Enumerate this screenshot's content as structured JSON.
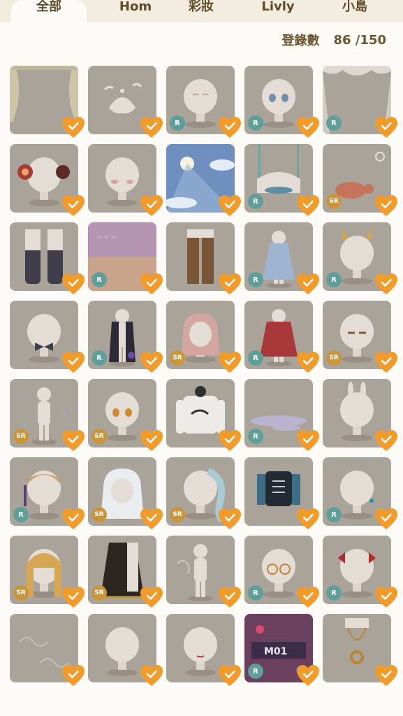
{
  "tabs": [
    {
      "label": "全部",
      "active": true
    },
    {
      "label": "Hom",
      "active": false
    },
    {
      "label": "彩妝",
      "active": false
    },
    {
      "label": "Livly",
      "active": false
    },
    {
      "label": "小島",
      "active": false
    }
  ],
  "registration": {
    "label": "登錄數",
    "count": "86 /150"
  },
  "colors": {
    "heart": "#f39b28",
    "tile_bg": "#aaa39a",
    "rarity_r": "#5f9f9a",
    "rarity_sr": "#c9963b"
  },
  "items": [
    {
      "icon": "curtain",
      "rarity": ""
    },
    {
      "icon": "splash",
      "rarity": ""
    },
    {
      "icon": "head-smile",
      "rarity": "R"
    },
    {
      "icon": "head-blue-eyes",
      "rarity": "R"
    },
    {
      "icon": "lace-curtain",
      "rarity": "R"
    },
    {
      "icon": "head-red-earmuffs",
      "rarity": ""
    },
    {
      "icon": "head-blush",
      "rarity": ""
    },
    {
      "icon": "sky-sun",
      "rarity": ""
    },
    {
      "icon": "bench-swing",
      "rarity": "R"
    },
    {
      "icon": "turtle",
      "rarity": "SR"
    },
    {
      "icon": "starry-stockings",
      "rarity": ""
    },
    {
      "icon": "pastel-sky",
      "rarity": "R"
    },
    {
      "icon": "brown-pants",
      "rarity": ""
    },
    {
      "icon": "plaid-dress",
      "rarity": "R"
    },
    {
      "icon": "head-gold-horns",
      "rarity": "R"
    },
    {
      "icon": "head-bow-tie",
      "rarity": ""
    },
    {
      "icon": "galaxy-coat",
      "rarity": "R"
    },
    {
      "icon": "pink-hair",
      "rarity": "SR"
    },
    {
      "icon": "red-cape",
      "rarity": "R"
    },
    {
      "icon": "head-sleepy-eyes",
      "rarity": "SR"
    },
    {
      "icon": "bubble-body",
      "rarity": "SR"
    },
    {
      "icon": "head-orange-eyes",
      "rarity": "SR"
    },
    {
      "icon": "livly-sweater",
      "rarity": ""
    },
    {
      "icon": "floor-mist",
      "rarity": "R"
    },
    {
      "icon": "bunny-ears",
      "rarity": ""
    },
    {
      "icon": "blonde-bangs",
      "rarity": "R"
    },
    {
      "icon": "white-long-hair",
      "rarity": "SR"
    },
    {
      "icon": "blue-wave-hair",
      "rarity": "SR"
    },
    {
      "icon": "skeleton-top",
      "rarity": ""
    },
    {
      "icon": "head-earring",
      "rarity": "R"
    },
    {
      "icon": "golden-braids",
      "rarity": "SR"
    },
    {
      "icon": "black-gold-skirt",
      "rarity": "SR"
    },
    {
      "icon": "smoke-body",
      "rarity": ""
    },
    {
      "icon": "round-glasses",
      "rarity": "R"
    },
    {
      "icon": "red-ribbons",
      "rarity": "R"
    },
    {
      "icon": "wind-swirls",
      "rarity": ""
    },
    {
      "icon": "head-white-hair",
      "rarity": ""
    },
    {
      "icon": "head-lips",
      "rarity": ""
    },
    {
      "icon": "m01-neon",
      "rarity": "R"
    },
    {
      "icon": "gold-necklace",
      "rarity": ""
    }
  ]
}
